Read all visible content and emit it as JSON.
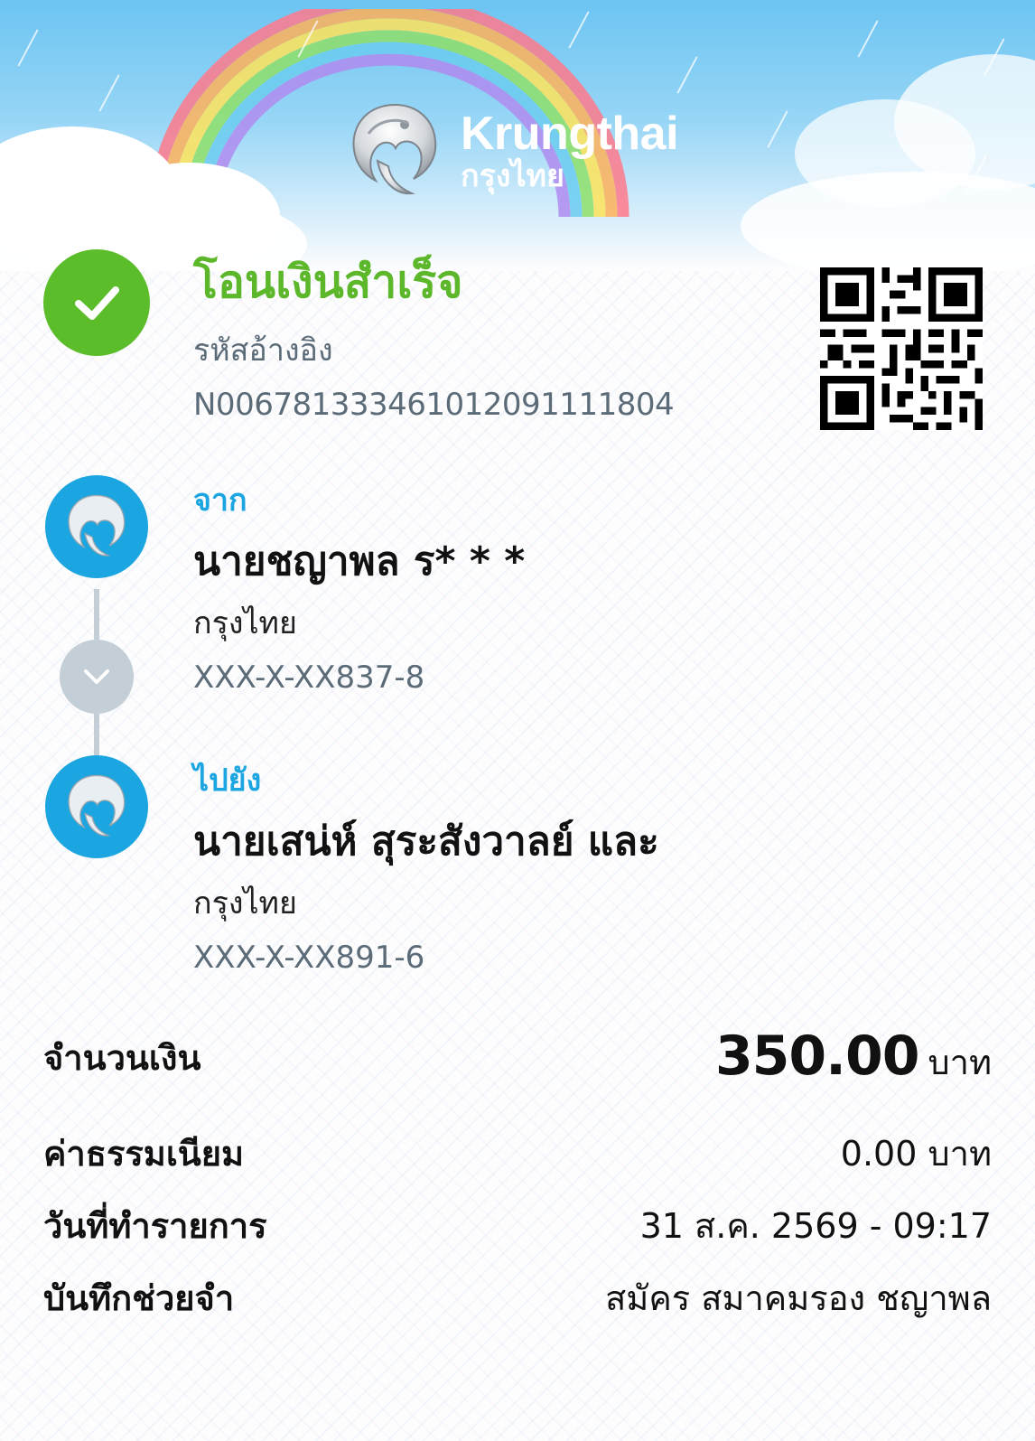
{
  "header": {
    "brand_name": "Krungthai",
    "brand_name_thai": "กรุงไทย"
  },
  "status": {
    "title": "โอนเงินสำเร็จ",
    "reference_label": "รหัสอ้างอิง",
    "reference_value": "N006781333461012091111804"
  },
  "sender": {
    "label": "จาก",
    "name": "นายชญาพล ร* * *",
    "bank": "กรุงไทย",
    "account": "XXX-X-XX837-8"
  },
  "recipient": {
    "label": "ไปยัง",
    "name": "นายเสน่ห์ สุระสังวาลย์ และ",
    "bank": "กรุงไทย",
    "account": "XXX-X-XX891-6"
  },
  "details": {
    "amount_label": "จำนวนเงิน",
    "amount_value": "350.00",
    "amount_unit": "บาท",
    "fee_label": "ค่าธรรมเนียม",
    "fee_value": "0.00 บาท",
    "date_label": "วันที่ทำรายการ",
    "date_value": "31 ส.ค. 2569 - 09:17",
    "memo_label": "บันทึกช่วยจำ",
    "memo_value": "สมัคร สมาคมรอง ชญาพล"
  },
  "colors": {
    "success_green": "#5cbd2a",
    "brand_blue": "#1ba5e1",
    "muted_text": "#5b6b78",
    "connector_gray": "#c4ced6"
  },
  "icons": {
    "status": "check-icon",
    "logo": "krungthai-phoenix-logo",
    "flow": "chevron-down-icon",
    "qr": "qr-code"
  }
}
